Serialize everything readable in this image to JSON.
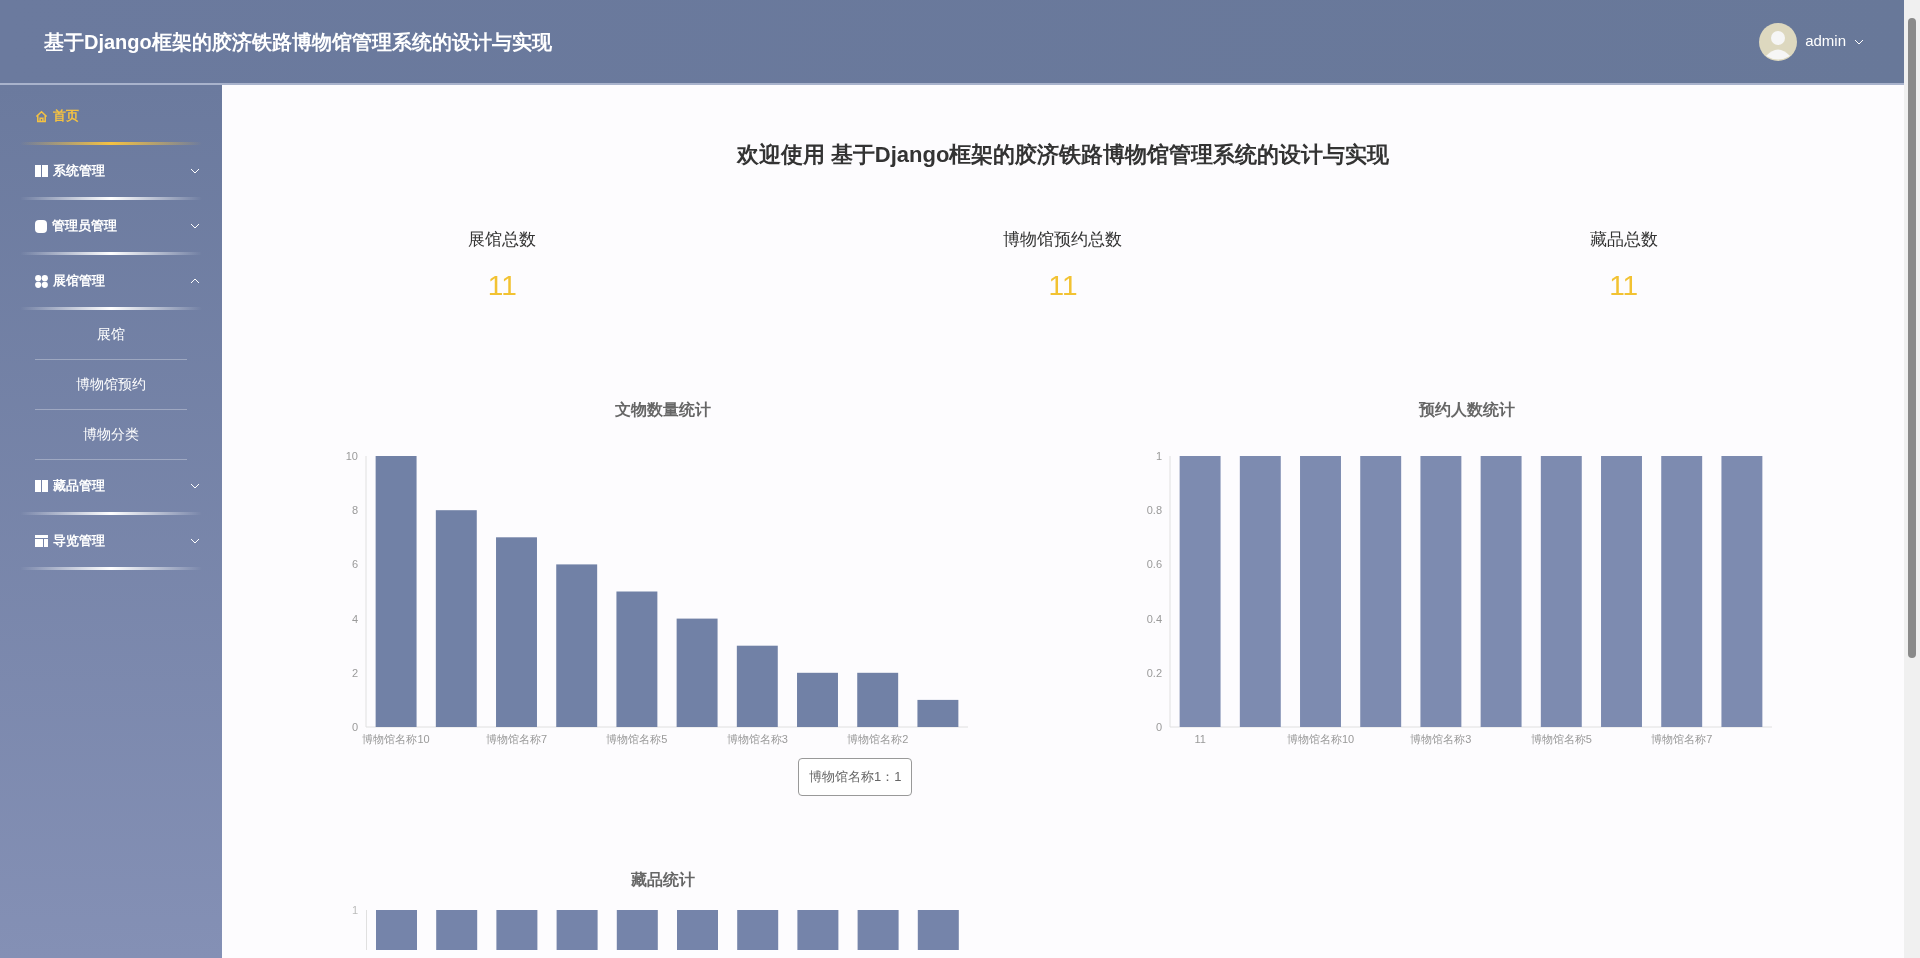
{
  "header": {
    "title": "基于Django框架的胶济铁路博物馆管理系统的设计与实现",
    "user": "admin"
  },
  "sidebar": {
    "items": [
      {
        "kind": "link",
        "label": "首页",
        "selected": true
      },
      {
        "kind": "group",
        "label": "系统管理",
        "selected": false,
        "expanded": false
      },
      {
        "kind": "group",
        "label": "管理员管理",
        "selected": false,
        "expanded": false
      },
      {
        "kind": "group",
        "label": "展馆管理",
        "selected": false,
        "expanded": true,
        "children": [
          {
            "label": "展馆",
            "selected": false
          },
          {
            "label": "博物馆预约",
            "selected": false
          },
          {
            "label": "博物分类",
            "selected": false
          }
        ]
      },
      {
        "kind": "group",
        "label": "藏品管理",
        "selected": false,
        "expanded": false
      },
      {
        "kind": "group",
        "label": "导览管理",
        "selected": false,
        "expanded": false
      }
    ]
  },
  "welcome": "欢迎使用 基于Django框架的胶济铁路博物馆管理系统的设计与实现",
  "stats": [
    {
      "label": "展馆总数",
      "value": "11"
    },
    {
      "label": "博物馆预约总数",
      "value": "11"
    },
    {
      "label": "藏品总数",
      "value": "11"
    }
  ],
  "charts": [
    {
      "chart_data": {
        "type": "bar",
        "title": "文物数量统计",
        "categories": [
          "博物馆名称10",
          null,
          "博物馆名称7",
          null,
          "博物馆名称5",
          null,
          "博物馆名称3",
          null,
          "博物馆名称2",
          null
        ],
        "series": [
          {
            "color": "#7181a6",
            "values": [
              10,
              8,
              7,
              6,
              5,
              4,
              3,
              2,
              2,
              1
            ]
          }
        ],
        "ylim": [
          0,
          10
        ],
        "yticks": [
          0,
          2,
          4,
          6,
          8,
          10
        ]
      },
      "tooltip": "博物馆名称1：1"
    },
    {
      "chart_data": {
        "type": "bar",
        "title": "预约人数统计",
        "categories": [
          "11",
          null,
          "博物馆名称10",
          null,
          "博物馆名称3",
          null,
          "博物馆名称5",
          null,
          "博物馆名称7",
          null
        ],
        "series": [
          {
            "color": "#7d8bb0",
            "values": [
              1,
              1,
              1,
              1,
              1,
              1,
              1,
              1,
              1,
              1
            ]
          }
        ],
        "ylim": [
          0,
          1
        ],
        "yticks": [
          {
            "value": 0,
            "label": "0"
          },
          {
            "value": 0.2,
            "label": "0.2"
          },
          {
            "value": 0.4,
            "label": "0.4"
          },
          {
            "value": 0.6,
            "label": "0.6"
          },
          {
            "value": 0.8,
            "label": "0.8"
          },
          {
            "value": 1,
            "label": "1"
          }
        ]
      }
    }
  ],
  "collection_chart": {
    "title": "藏品统计",
    "tick_label": "1"
  }
}
